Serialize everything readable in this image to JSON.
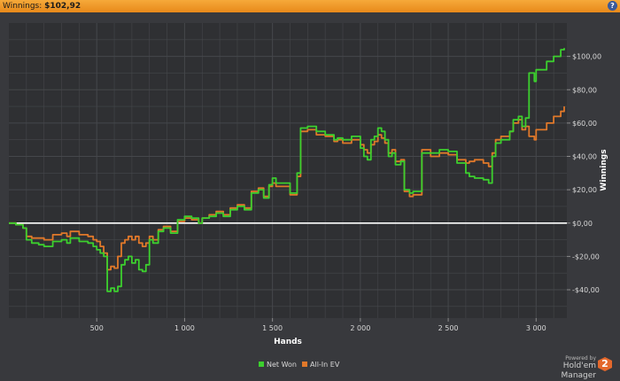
{
  "header": {
    "winnings_label": "Winnings:",
    "winnings_value": "$102,92",
    "help_glyph": "?"
  },
  "branding": {
    "powered_by": "Powered by",
    "product": "Hold'em Manager",
    "logo_glyph": "2"
  },
  "colors": {
    "background": "#38393d",
    "plot_bg": "#2f3033",
    "grid": "#45474b",
    "net_won": "#3ccf2e",
    "all_in_ev": "#e0782a",
    "zero_line": "#ffffff",
    "accent": "#f29b2e"
  },
  "chart_data": {
    "type": "line",
    "title": "",
    "xlabel": "Hands",
    "ylabel": "Winnings",
    "xlim": [
      0,
      3175
    ],
    "ylim": [
      -57,
      120
    ],
    "x_ticks": [
      500,
      1000,
      1500,
      2000,
      2500,
      3000
    ],
    "x_tick_labels": [
      "500",
      "1 000",
      "1 500",
      "2 000",
      "2 500",
      "3 000"
    ],
    "y_ticks": [
      -40,
      -20,
      0,
      20,
      40,
      60,
      80,
      100
    ],
    "y_tick_labels": [
      "-$40,00",
      "-$20,00",
      "$0,00",
      "$20,00",
      "$40,00",
      "$60,00",
      "$80,00",
      "$100,00"
    ],
    "grid": true,
    "legend": "bottom-center",
    "series": [
      {
        "name": "Net Won",
        "color": "#3ccf2e",
        "x": [
          0,
          40,
          80,
          100,
          130,
          170,
          200,
          250,
          300,
          330,
          350,
          400,
          450,
          480,
          500,
          520,
          540,
          560,
          580,
          600,
          620,
          640,
          660,
          680,
          700,
          720,
          740,
          760,
          780,
          800,
          820,
          850,
          880,
          920,
          960,
          1000,
          1040,
          1080,
          1100,
          1140,
          1180,
          1220,
          1260,
          1300,
          1340,
          1380,
          1420,
          1450,
          1480,
          1500,
          1520,
          1550,
          1600,
          1640,
          1660,
          1700,
          1750,
          1800,
          1850,
          1870,
          1900,
          1950,
          2000,
          2020,
          2040,
          2060,
          2080,
          2100,
          2120,
          2140,
          2160,
          2180,
          2200,
          2230,
          2250,
          2280,
          2300,
          2350,
          2400,
          2450,
          2500,
          2550,
          2600,
          2620,
          2650,
          2700,
          2730,
          2750,
          2770,
          2800,
          2850,
          2870,
          2900,
          2920,
          2940,
          2960,
          2990,
          3000,
          3030,
          3060,
          3100,
          3140,
          3160
        ],
        "y": [
          0,
          -1,
          -3,
          -10,
          -12,
          -13,
          -14,
          -11,
          -10,
          -12,
          -9,
          -11,
          -12,
          -14,
          -16,
          -18,
          -20,
          -41,
          -39,
          -41,
          -38,
          -25,
          -22,
          -20,
          -24,
          -22,
          -28,
          -29,
          -25,
          -10,
          -12,
          -5,
          -3,
          -6,
          2,
          4,
          3,
          0,
          3,
          4,
          6,
          4,
          8,
          10,
          8,
          18,
          20,
          15,
          23,
          27,
          24,
          24,
          18,
          30,
          57,
          58,
          55,
          53,
          50,
          51,
          50,
          52,
          45,
          40,
          38,
          50,
          52,
          57,
          55,
          50,
          40,
          42,
          35,
          37,
          20,
          18,
          19,
          42,
          42,
          44,
          43,
          36,
          30,
          28,
          27,
          26,
          24,
          40,
          48,
          50,
          55,
          62,
          64,
          58,
          63,
          90,
          85,
          92,
          92,
          97,
          100,
          104,
          105
        ],
        "final_value": 102.92
      },
      {
        "name": "All-In EV",
        "color": "#e0782a",
        "x": [
          0,
          40,
          80,
          100,
          130,
          170,
          200,
          250,
          300,
          330,
          350,
          400,
          450,
          480,
          500,
          520,
          540,
          560,
          580,
          600,
          620,
          640,
          660,
          680,
          700,
          720,
          740,
          760,
          780,
          800,
          820,
          850,
          880,
          920,
          960,
          1000,
          1040,
          1080,
          1100,
          1140,
          1180,
          1220,
          1260,
          1300,
          1340,
          1380,
          1420,
          1450,
          1480,
          1500,
          1520,
          1550,
          1600,
          1640,
          1660,
          1700,
          1750,
          1800,
          1850,
          1870,
          1900,
          1950,
          2000,
          2020,
          2040,
          2060,
          2080,
          2100,
          2120,
          2140,
          2160,
          2180,
          2200,
          2230,
          2250,
          2280,
          2300,
          2350,
          2400,
          2450,
          2500,
          2550,
          2600,
          2620,
          2650,
          2700,
          2730,
          2750,
          2770,
          2800,
          2850,
          2870,
          2900,
          2920,
          2940,
          2960,
          2990,
          3000,
          3030,
          3060,
          3100,
          3140,
          3160
        ],
        "y": [
          0,
          -1,
          -3,
          -8,
          -9,
          -9,
          -10,
          -7,
          -6,
          -8,
          -5,
          -7,
          -8,
          -10,
          -11,
          -14,
          -18,
          -28,
          -26,
          -27,
          -20,
          -12,
          -10,
          -8,
          -10,
          -8,
          -12,
          -14,
          -12,
          -8,
          -10,
          -4,
          -2,
          -5,
          1,
          3,
          2,
          0,
          3,
          5,
          7,
          5,
          9,
          11,
          9,
          19,
          21,
          16,
          22,
          24,
          22,
          22,
          17,
          28,
          55,
          56,
          53,
          52,
          49,
          50,
          48,
          50,
          47,
          44,
          42,
          47,
          49,
          53,
          51,
          48,
          42,
          44,
          37,
          38,
          19,
          16,
          17,
          44,
          40,
          42,
          41,
          38,
          36,
          37,
          38,
          36,
          34,
          42,
          50,
          52,
          55,
          60,
          62,
          56,
          58,
          52,
          50,
          56,
          56,
          60,
          64,
          67,
          70
        ],
        "final_value": 70
      }
    ]
  }
}
